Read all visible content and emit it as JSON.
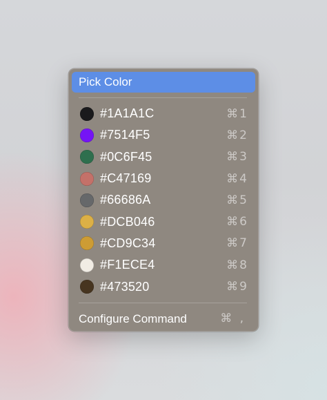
{
  "menu": {
    "title": "Pick Color",
    "colors": [
      {
        "hex": "#1A1A1C",
        "shortcut": "⌘1",
        "swatch": "#1A1A1C"
      },
      {
        "hex": "#7514F5",
        "shortcut": "⌘2",
        "swatch": "#7514F5"
      },
      {
        "hex": "#0C6F45",
        "shortcut": "⌘3",
        "swatch": "#2E6F4E"
      },
      {
        "hex": "#C47169",
        "shortcut": "⌘4",
        "swatch": "#C47169"
      },
      {
        "hex": "#66686A",
        "shortcut": "⌘5",
        "swatch": "#66686A"
      },
      {
        "hex": "#DCB046",
        "shortcut": "⌘6",
        "swatch": "#DCB046"
      },
      {
        "hex": "#CD9C34",
        "shortcut": "⌘7",
        "swatch": "#CD9C34"
      },
      {
        "hex": "#F1ECE4",
        "shortcut": "⌘8",
        "swatch": "#F1ECE4"
      },
      {
        "hex": "#473520",
        "shortcut": "⌘9",
        "swatch": "#473520"
      }
    ],
    "configure_label": "Configure Command",
    "configure_shortcut": "⌘ ,"
  },
  "theme": {
    "menu_background": "#8F8880",
    "highlight": "#5D8EE6"
  }
}
